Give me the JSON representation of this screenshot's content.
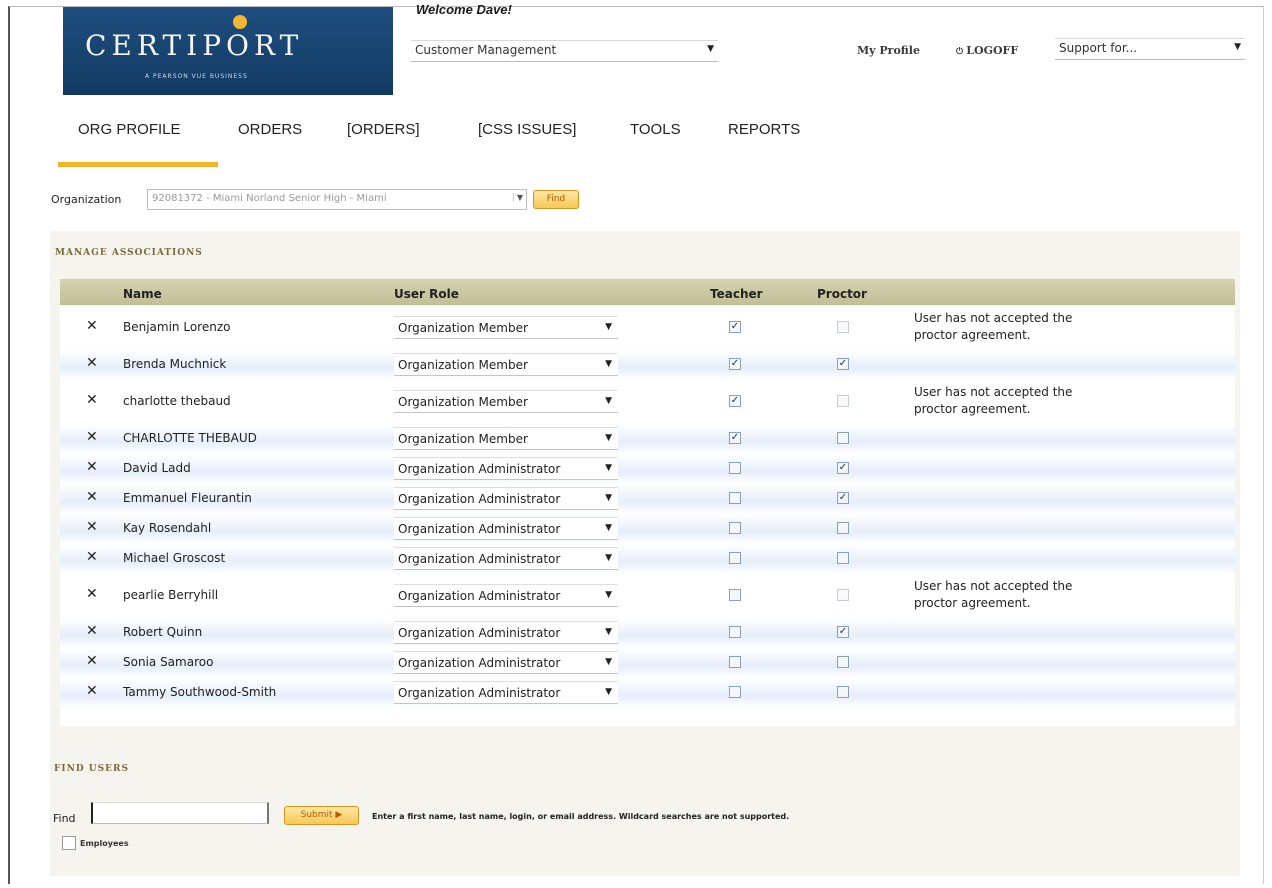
{
  "header": {
    "logo_text": "CERTIPORT",
    "logo_sub": "A PEARSON VUE BUSINESS",
    "welcome": "Welcome Dave!",
    "app_select": "Customer Management",
    "my_profile": "My Profile",
    "logoff": "LOGOFF",
    "support_select": "Support for..."
  },
  "nav": {
    "items": [
      "ORG PROFILE",
      "ORDERS",
      "[ORDERS]",
      "[CSS ISSUES]",
      "TOOLS",
      "REPORTS"
    ],
    "active": "ORG PROFILE",
    "accent": "#f0b52a"
  },
  "organization": {
    "label": "Organization",
    "value": "92081372 - Miami Norland Senior High - Miami",
    "find_label": "Find"
  },
  "manage": {
    "title": "MANAGE ASSOCIATIONS",
    "columns": {
      "name": "Name",
      "role": "User Role",
      "teacher": "Teacher",
      "proctor": "Proctor"
    },
    "remove_glyph": "✕",
    "rows": [
      {
        "name": "Benjamin Lorenzo",
        "role": "Organization Member",
        "teacher": true,
        "proctor": false,
        "proctor_disabled": true,
        "note": [
          "User has not accepted the",
          "proctor agreement."
        ]
      },
      {
        "name": "Brenda Muchnick",
        "role": "Organization Member",
        "teacher": true,
        "proctor": true,
        "proctor_disabled": false,
        "note": []
      },
      {
        "name": "charlotte thebaud",
        "role": "Organization Member",
        "teacher": true,
        "proctor": false,
        "proctor_disabled": true,
        "note": [
          "User has not accepted the",
          "proctor agreement."
        ]
      },
      {
        "name": "CHARLOTTE THEBAUD",
        "role": "Organization Member",
        "teacher": true,
        "proctor": false,
        "proctor_disabled": false,
        "note": []
      },
      {
        "name": "David Ladd",
        "role": "Organization Administrator",
        "teacher": false,
        "proctor": true,
        "proctor_disabled": false,
        "note": []
      },
      {
        "name": "Emmanuel Fleurantin",
        "role": "Organization Administrator",
        "teacher": false,
        "proctor": true,
        "proctor_disabled": false,
        "note": []
      },
      {
        "name": "Kay Rosendahl",
        "role": "Organization Administrator",
        "teacher": false,
        "proctor": false,
        "proctor_disabled": false,
        "note": []
      },
      {
        "name": "Michael Groscost",
        "role": "Organization Administrator",
        "teacher": false,
        "proctor": false,
        "proctor_disabled": false,
        "note": []
      },
      {
        "name": "pearlie Berryhill",
        "role": "Organization Administrator",
        "teacher": false,
        "proctor": false,
        "proctor_disabled": true,
        "note": [
          "User has not accepted the",
          "proctor agreement."
        ]
      },
      {
        "name": "Robert Quinn",
        "role": "Organization Administrator",
        "teacher": false,
        "proctor": true,
        "proctor_disabled": false,
        "note": []
      },
      {
        "name": "Sonia Samaroo",
        "role": "Organization Administrator",
        "teacher": false,
        "proctor": false,
        "proctor_disabled": false,
        "note": []
      },
      {
        "name": "Tammy Southwood-Smith",
        "role": "Organization Administrator",
        "teacher": false,
        "proctor": false,
        "proctor_disabled": false,
        "note": []
      }
    ]
  },
  "find_users": {
    "title": "FIND USERS",
    "label": "Find",
    "value": "",
    "submit": "Submit ▶",
    "help": "Enter a first name, last name, login, or email address. Wildcard searches are not supported.",
    "employees_label": "Employees",
    "employees_checked": false
  }
}
